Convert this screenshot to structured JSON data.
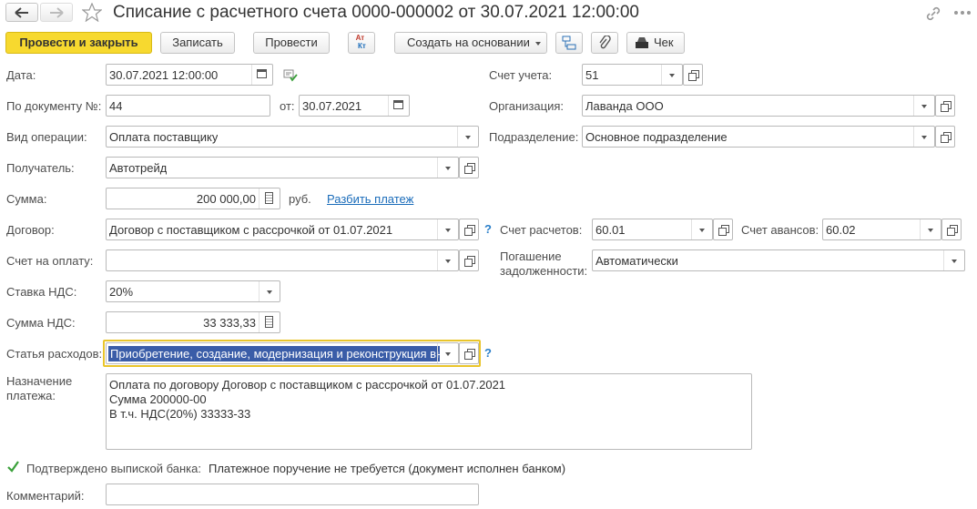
{
  "header": {
    "title": "Списание с расчетного счета 0000-000002 от 30.07.2021 12:00:00"
  },
  "toolbar": {
    "post_close": "Провести и закрыть",
    "save": "Записать",
    "post": "Провести",
    "dt_kt_top": "Ат",
    "dt_kt_bottom": "Кт",
    "create_based": "Создать на основании",
    "receipt": "Чек"
  },
  "form": {
    "date_label": "Дата:",
    "date_value": "30.07.2021 12:00:00",
    "doc_num_label": "По документу №:",
    "doc_num_value": "44",
    "from_label": "от:",
    "from_value": "30.07.2021",
    "operation_label": "Вид операции:",
    "operation_value": "Оплата поставщику",
    "recipient_label": "Получатель:",
    "recipient_value": "Автотрейд",
    "sum_label": "Сумма:",
    "sum_value": "200 000,00",
    "currency": "руб.",
    "split_link": "Разбить платеж",
    "contract_label": "Договор:",
    "contract_value": "Договор с поставщиком с рассрочкой от 01.07.2021",
    "invoice_label": "Счет на оплату:",
    "invoice_value": "",
    "vat_rate_label": "Ставка НДС:",
    "vat_rate_value": "20%",
    "vat_sum_label": "Сумма НДС:",
    "vat_sum_value": "33 333,33",
    "expense_label": "Статья расходов:",
    "expense_value": "Приобретение, создание, модернизация и реконструкция вн",
    "purpose_label_1": "Назначение",
    "purpose_label_2": "платежа:",
    "purpose_line_1": "Оплата по договору Договор с поставщиком с рассрочкой от 01.07.2021",
    "purpose_line_2": "Сумма 200000-00",
    "purpose_line_3": "В т.ч. НДС(20%) 33333-33",
    "confirmed_label": "Подтверждено выпиской банка:",
    "confirmed_note": "Платежное поручение не требуется (документ исполнен банком)",
    "comment_label": "Комментарий:",
    "comment_value": "",
    "account_label": "Счет учета:",
    "account_value": "51",
    "org_label": "Организация:",
    "org_value": "Лаванда ООО",
    "division_label": "Подразделение:",
    "division_value": "Основное подразделение",
    "settle_acc_label": "Счет расчетов:",
    "settle_acc_value": "60.01",
    "advance_acc_label": "Счет авансов:",
    "advance_acc_value": "60.02",
    "repay_label_1": "Погашение",
    "repay_label_2": "задолженности:",
    "repay_value": "Автоматически",
    "help": "?"
  },
  "colors": {
    "primary_button": "#f7d92f",
    "focus_border": "#e9c52a",
    "selection": "#3a5da8",
    "link": "#1a6cba"
  }
}
